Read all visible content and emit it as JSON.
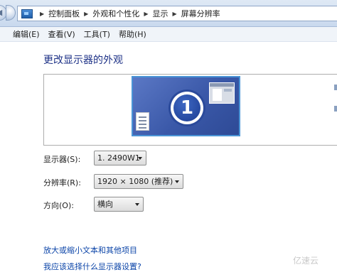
{
  "address_bar": {
    "breadcrumbs": [
      "控制面板",
      "外观和个性化",
      "显示",
      "屏幕分辨率"
    ]
  },
  "menu": {
    "items": [
      "编辑(E)",
      "查看(V)",
      "工具(T)",
      "帮助(H)"
    ]
  },
  "main": {
    "heading": "更改显示器的外观",
    "monitor_number": "1",
    "display_label": "显示器(S):",
    "display_value": "1. 2490W1",
    "resolution_label": "分辨率(R):",
    "resolution_value": "1920 × 1080 (推荐)",
    "orientation_label": "方向(O):",
    "orientation_value": "横向"
  },
  "links": {
    "text_size": "放大或缩小文本和其他项目",
    "which_settings": "我应该选择什么显示器设置?"
  },
  "watermark": "亿速云",
  "colors": {
    "heading": "#1e3287",
    "link": "#0b44a8",
    "monitor_fill": "#3a58a8",
    "monitor_border": "#4a94d6"
  }
}
